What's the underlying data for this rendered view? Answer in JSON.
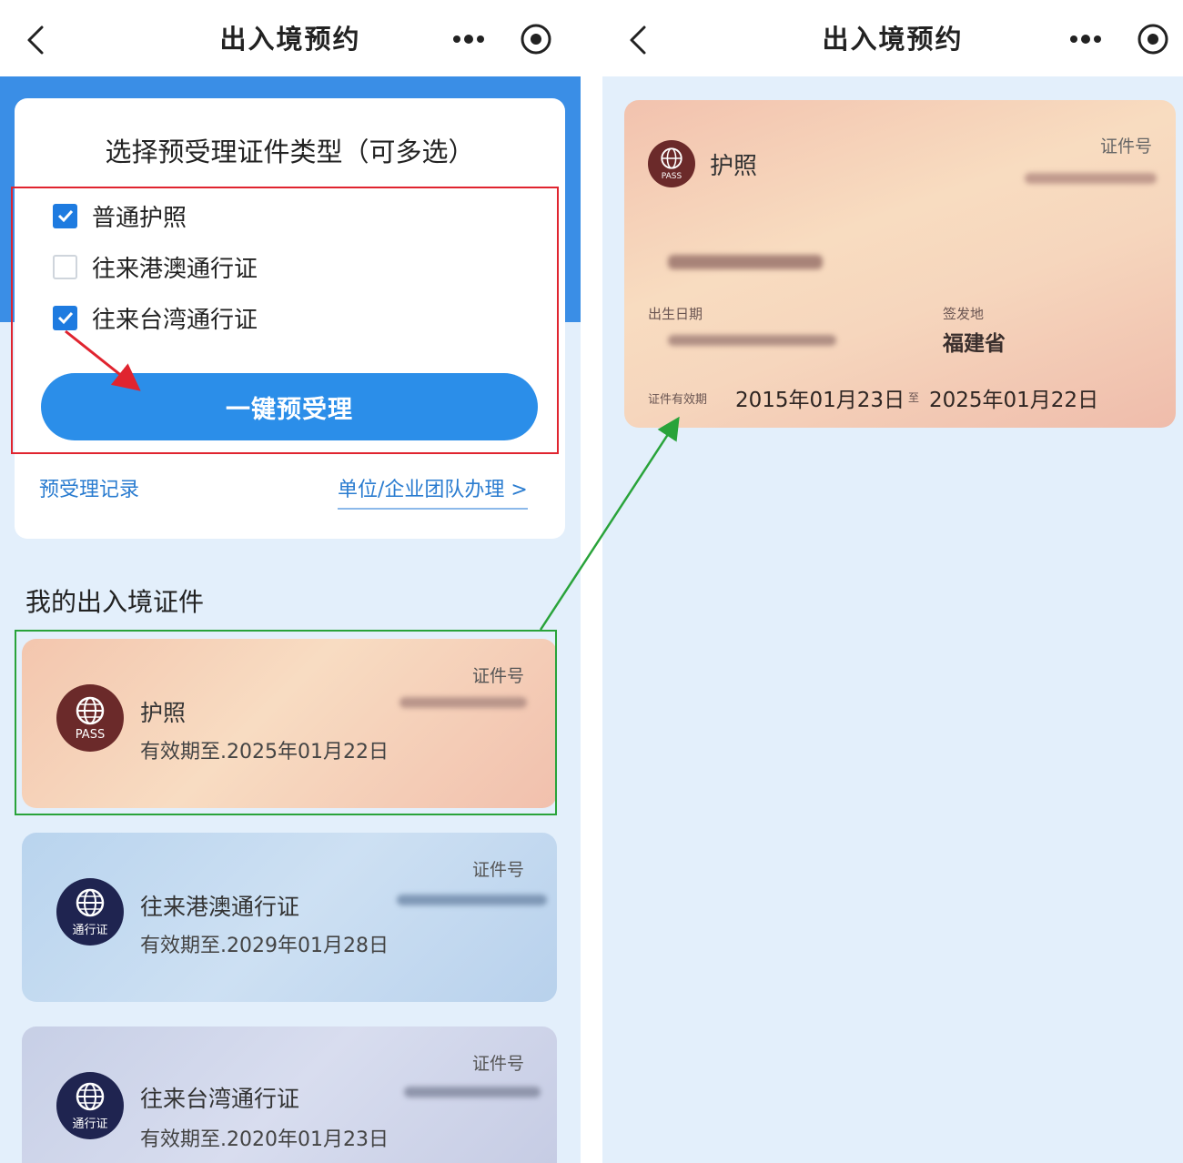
{
  "left_screen": {
    "nav": {
      "title": "出入境预约"
    },
    "panel": {
      "title": "选择预受理证件类型（可多选）",
      "options": [
        {
          "label": "普通护照",
          "checked": true
        },
        {
          "label": "往来港澳通行证",
          "checked": false
        },
        {
          "label": "往来台湾通行证",
          "checked": true
        }
      ],
      "submit_label": "一键预受理",
      "history_link": "预受理记录",
      "group_link": "单位/企业团队办理 >"
    },
    "section_title": "我的出入境证件",
    "cards": [
      {
        "name": "护照",
        "emblem_text": "PASS",
        "validity": "有效期至.2025年01月22日",
        "number_label": "证件号",
        "theme": "#f3c6ae"
      },
      {
        "name": "往来港澳通行证",
        "emblem_text": "通行证",
        "validity": "有效期至.2029年01月28日",
        "number_label": "证件号",
        "theme": "#b9d4ee"
      },
      {
        "name": "往来台湾通行证",
        "emblem_text": "通行证",
        "validity": "有效期至.2020年01月23日",
        "number_label": "证件号",
        "theme": "#c7cfe6"
      }
    ]
  },
  "right_screen": {
    "nav": {
      "title": "出入境预约"
    },
    "card": {
      "name": "护照",
      "emblem_text": "PASS",
      "number_label": "证件号",
      "birth_label": "出生日期",
      "issue_place_label": "签发地",
      "issue_place": "福建省",
      "validity_label": "证件有效期",
      "valid_from": "2015年01月23日",
      "separator": "至",
      "valid_to": "2025年01月22日"
    }
  },
  "colors": {
    "primary_blue": "#2b8ee9",
    "highlight_red": "#e0242f",
    "highlight_green": "#29a33a",
    "background": "#e3effb"
  },
  "icons": [
    "back-chevron-icon",
    "more-dots-icon",
    "target-circle-icon",
    "checkbox-icon",
    "globe-emblem-icon"
  ]
}
